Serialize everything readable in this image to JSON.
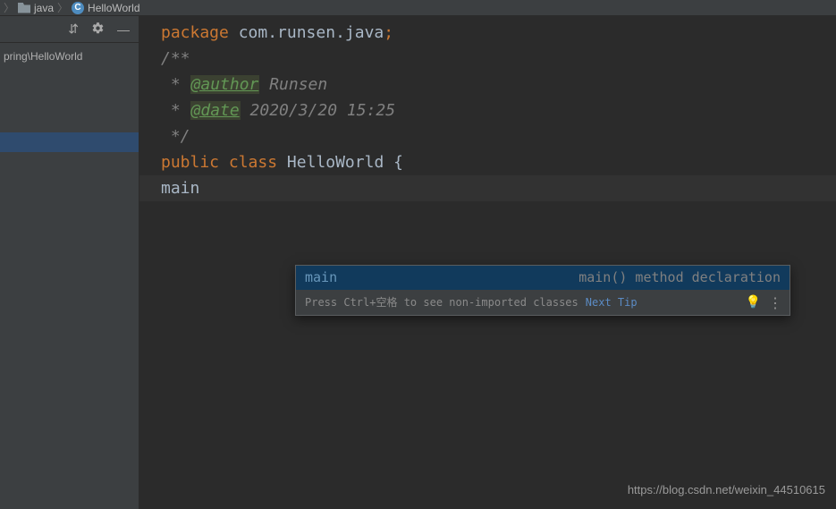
{
  "breadcrumb": {
    "sep1": "〉",
    "folder": "java",
    "sep2": "〉",
    "file": "HelloWorld"
  },
  "sidebar": {
    "path": "pring\\HelloWorld"
  },
  "code": {
    "package_kw": "package",
    "package_name": " com.runsen.java",
    "package_semi": ";",
    "blank": "",
    "doc_open": "/**",
    "doc_author_star": " * ",
    "doc_author_tag": "@author",
    "doc_author_val": " Runsen",
    "doc_date_star": " * ",
    "doc_date_tag": "@date",
    "doc_date_val": " 2020/3/20 15:25",
    "doc_close": " */",
    "public_kw": "public",
    "space1": " ",
    "class_kw": "class",
    "space2": " ",
    "class_name": "HelloWorld",
    "space3": " ",
    "brace_open": "{",
    "typed": "main"
  },
  "popup": {
    "item_left": "main",
    "item_right": "main() method declaration",
    "hint": "Press Ctrl+空格 to see non-imported classes",
    "next_tip": "Next Tip"
  },
  "watermark": "https://blog.csdn.net/weixin_44510615"
}
